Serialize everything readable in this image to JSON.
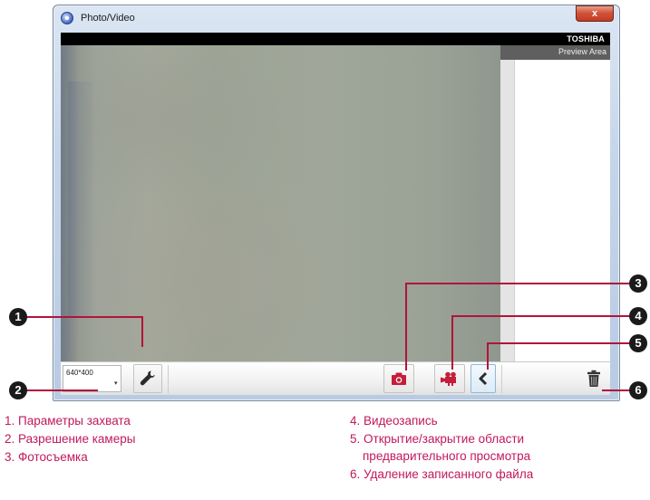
{
  "window": {
    "title": "Photo/Video",
    "close_label": "x",
    "brand": "TOSHIBA",
    "preview_area_label": "Preview Area"
  },
  "toolbar": {
    "resolution_value": "640*400",
    "resolution_arrow": "▾"
  },
  "callouts": [
    "1",
    "2",
    "3",
    "4",
    "5",
    "6"
  ],
  "captions": [
    "1. Параметры захвата",
    "2. Разрешение камеры",
    "3. Фотосъемка",
    "4. Видеозапись",
    "5. Открытие/закрытие области",
    "предварительного просмотра",
    "6. Удаление записанного файла"
  ],
  "colors": {
    "accent_red": "#b3133a",
    "caption_color": "#c2185b",
    "icon_red": "#c41e3a",
    "callout_bg": "#1a1a1a"
  },
  "icons": [
    "camera-app-icon",
    "wrench-icon",
    "camera-icon",
    "video-camera-icon",
    "chevron-left-icon",
    "trash-icon"
  ]
}
